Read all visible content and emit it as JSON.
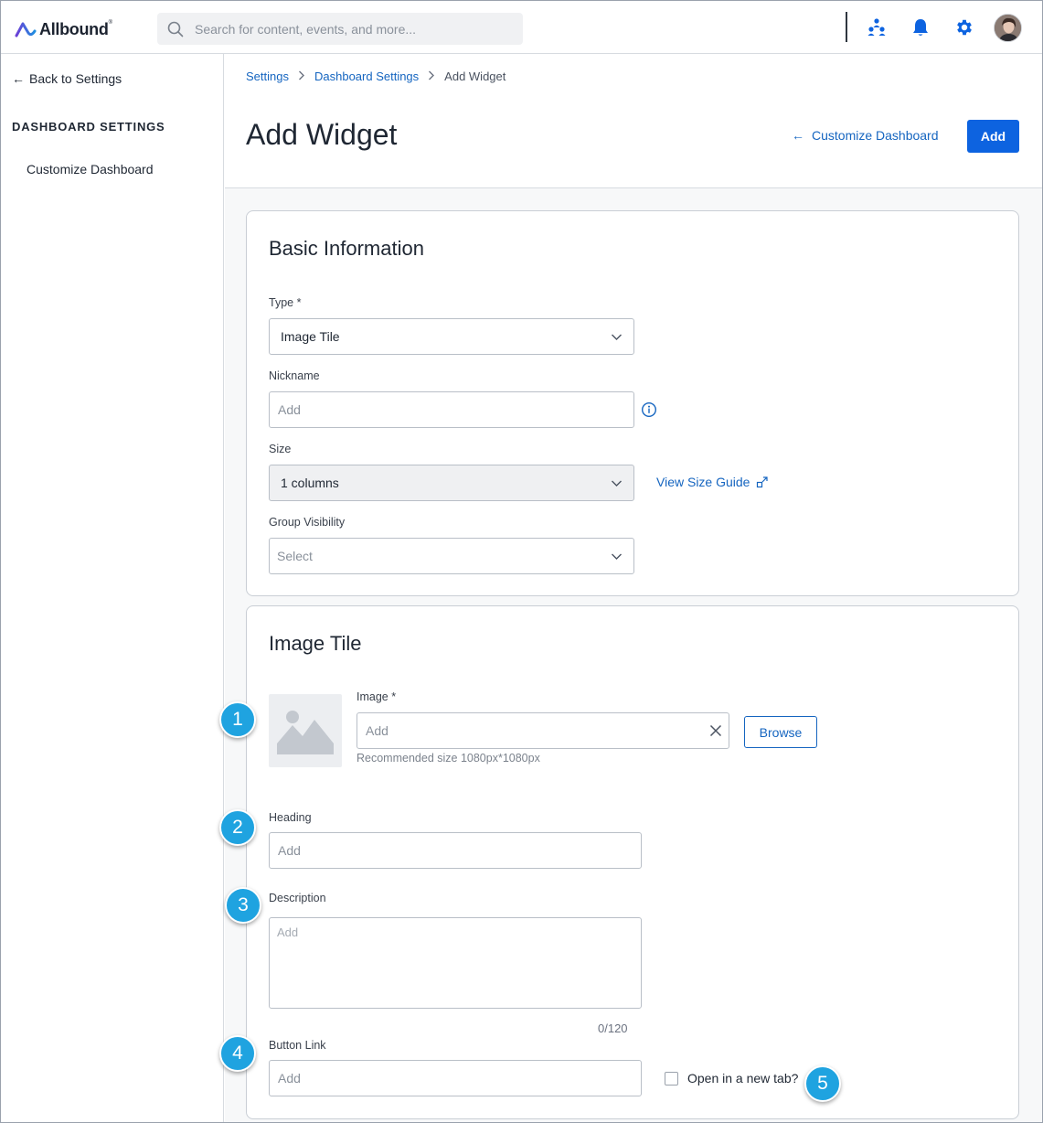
{
  "header": {
    "logo_text": "Allbound",
    "logo_mark": "®",
    "search_placeholder": "Search for content, events, and more...",
    "icons": [
      "partners-icon",
      "bell-icon",
      "gear-icon",
      "avatar"
    ],
    "accent_color": "#0d63e0"
  },
  "sidebar": {
    "back_label": "Back to Settings",
    "section_heading": "DASHBOARD SETTINGS",
    "items": [
      {
        "label": "Customize Dashboard"
      }
    ]
  },
  "main": {
    "breadcrumb": [
      "Settings",
      "Dashboard Settings",
      "Add Widget"
    ],
    "title": "Add Widget",
    "customize_link": "Customize Dashboard",
    "add_button": "Add"
  },
  "basic_info": {
    "title": "Basic Information",
    "type_label": "Type *",
    "type_value": "Image Tile",
    "nickname_label": "Nickname",
    "nickname_placeholder": "Add",
    "size_label": "Size",
    "size_value": "1 columns",
    "size_guide_link": "View Size Guide",
    "group_label": "Group Visibility",
    "group_placeholder": "Select"
  },
  "image_tile": {
    "title": "Image Tile",
    "image_label": "Image *",
    "image_placeholder": "Add",
    "browse_label": "Browse",
    "image_hint": "Recommended size 1080px*1080px",
    "heading_label": "Heading",
    "heading_placeholder": "Add",
    "description_label": "Description",
    "description_placeholder": "Add",
    "description_counter": "0/120",
    "button_link_label": "Button Link",
    "button_link_placeholder": "Add",
    "new_tab_label": "Open in a new tab?"
  },
  "callouts": [
    "1",
    "2",
    "3",
    "4",
    "5"
  ]
}
